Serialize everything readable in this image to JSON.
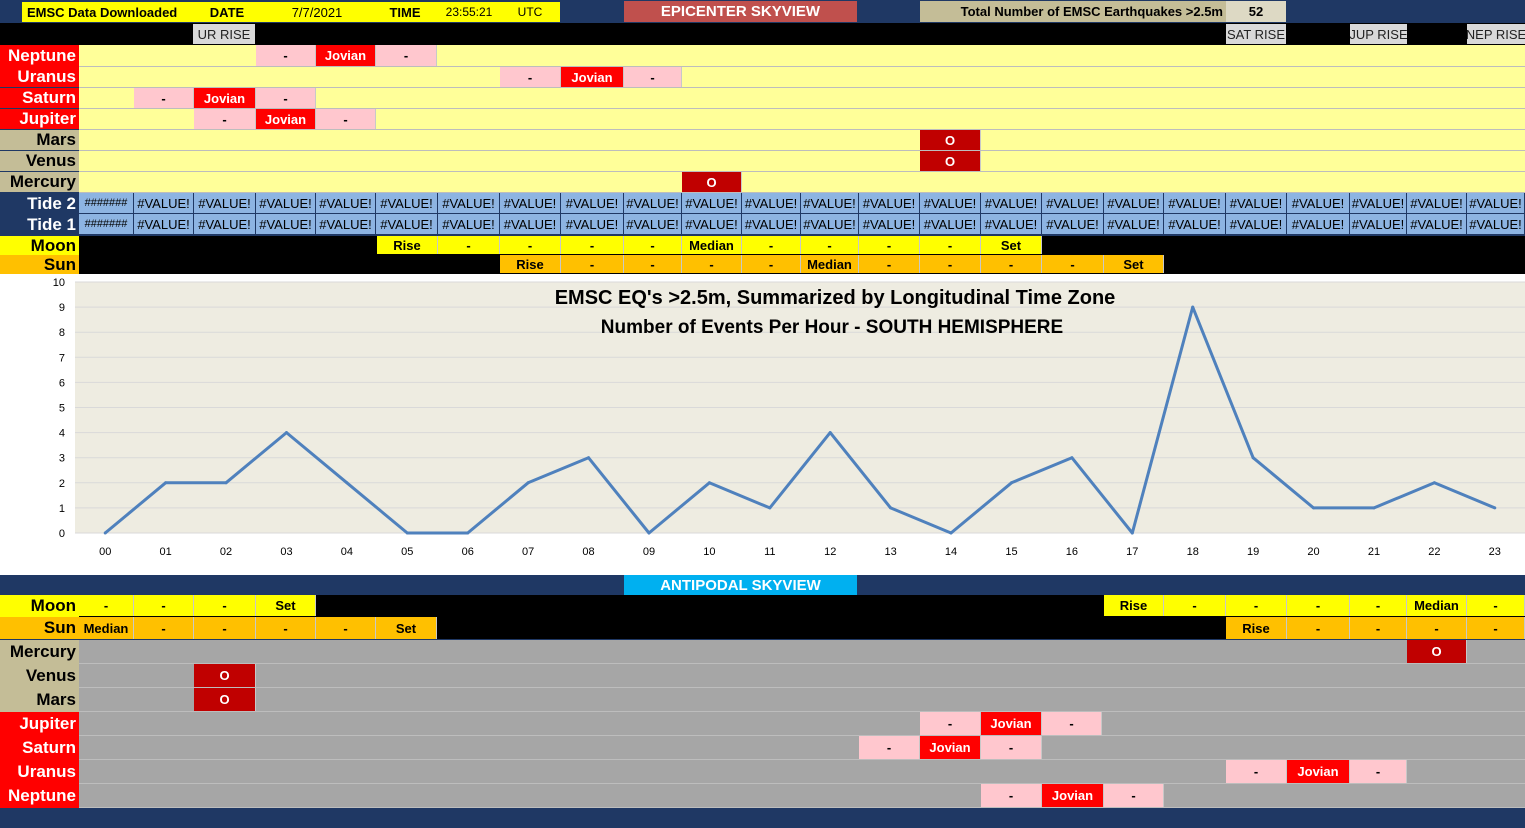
{
  "header": {
    "downloaded": "EMSC Data Downloaded",
    "date_label": "DATE",
    "date_value": "7/7/2021",
    "time_label": "TIME",
    "time_value": "23:55:21",
    "utc": "UTC",
    "epicenter_title": "EPICENTER SKYVIEW",
    "total_label": "Total Number of EMSC Earthquakes >2.5m",
    "total_value": "52"
  },
  "rise_labels": {
    "ur": "UR RISE",
    "sat": "SAT RISE",
    "jup": "JUP RISE",
    "nep": "NEP RISE"
  },
  "epicenter": {
    "neptune": "Neptune",
    "uranus": "Uranus",
    "saturn": "Saturn",
    "jupiter": "Jupiter",
    "mars": "Mars",
    "venus": "Venus",
    "mercury": "Mercury",
    "tide2": "Tide 2",
    "tide1": "Tide 1",
    "moon": "Moon",
    "sun": "Sun"
  },
  "antipodal": {
    "title": "ANTIPODAL SKYVIEW",
    "moon": "Moon",
    "sun": "Sun",
    "mercury": "Mercury",
    "venus": "Venus",
    "mars": "Mars",
    "jupiter": "Jupiter",
    "saturn": "Saturn",
    "uranus": "Uranus",
    "neptune": "Neptune"
  },
  "cells": {
    "dash": "-",
    "jovian": "Jovian",
    "o": "O",
    "rise": "Rise",
    "set": "Set",
    "median": "Median",
    "value_err": "#VALUE!",
    "hash": "#######"
  },
  "colors": {
    "yellow_row": "#ffff99",
    "gray_row": "#a6a6a6",
    "red_label": "#ff0000",
    "tan_label": "#c4bd97",
    "navy": "#1f3864",
    "pink": "#ffc7ce",
    "dark_red": "#c00000",
    "tide_blue": "#8db4e2",
    "moon_yellow": "#ffff00",
    "sun_orange": "#ffc000",
    "line": "#4f81bd",
    "plot_bg": "#eeece1"
  },
  "chart_data": {
    "type": "line",
    "title": "EMSC EQ's >2.5m, Summarized by Longitudinal Time Zone",
    "subtitle": "Number of Events Per Hour - SOUTH HEMISPHERE",
    "categories": [
      "00",
      "01",
      "02",
      "03",
      "04",
      "05",
      "06",
      "07",
      "08",
      "09",
      "10",
      "11",
      "12",
      "13",
      "14",
      "15",
      "16",
      "17",
      "18",
      "19",
      "20",
      "21",
      "22",
      "23"
    ],
    "values": [
      0,
      2,
      2,
      4,
      2,
      0,
      0,
      2,
      3,
      0,
      2,
      1,
      4,
      1,
      0,
      2,
      3,
      0,
      9,
      3,
      1,
      1,
      2,
      1
    ],
    "yticks": [
      "0",
      "1",
      "2",
      "3",
      "4",
      "5",
      "6",
      "7",
      "8",
      "9",
      "10"
    ],
    "ylim": [
      0,
      10
    ],
    "grid": true
  }
}
